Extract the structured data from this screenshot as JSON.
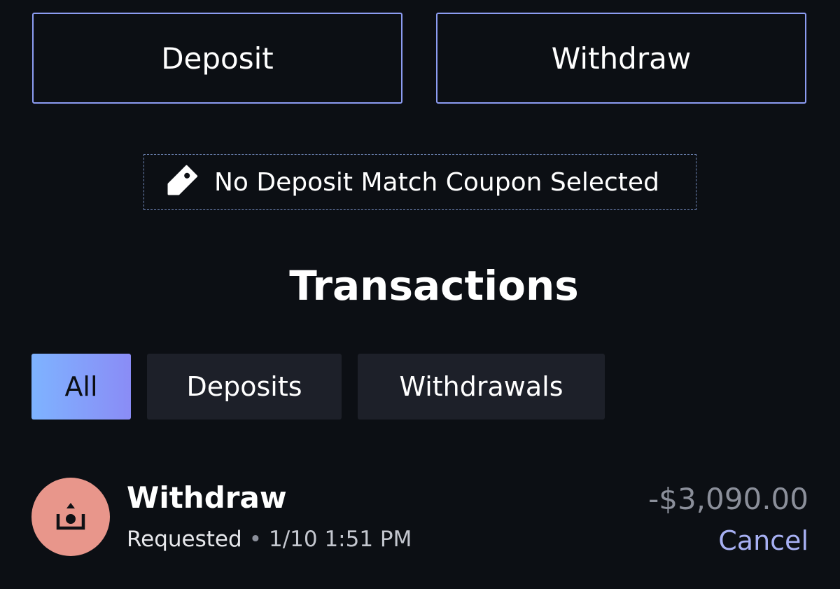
{
  "actions": {
    "deposit_label": "Deposit",
    "withdraw_label": "Withdraw"
  },
  "coupon": {
    "icon": "tag-icon",
    "text": "No Deposit Match Coupon Selected"
  },
  "transactions": {
    "title": "Transactions",
    "filters": [
      {
        "label": "All",
        "selected": true
      },
      {
        "label": "Deposits",
        "selected": false
      },
      {
        "label": "Withdrawals",
        "selected": false
      }
    ],
    "items": [
      {
        "icon": "withdraw-icon",
        "title": "Withdraw",
        "status": "Requested",
        "separator": "•",
        "datetime": "1/10 1:51 PM",
        "amount": "-$3,090.00",
        "action": "Cancel"
      }
    ]
  },
  "colors": {
    "background": "#0c0f14",
    "accent_border": "#8c9cf2",
    "accent_link": "#a7b0f3",
    "withdraw_icon_bg": "#e8968b",
    "tab_bg": "#1d2029"
  }
}
